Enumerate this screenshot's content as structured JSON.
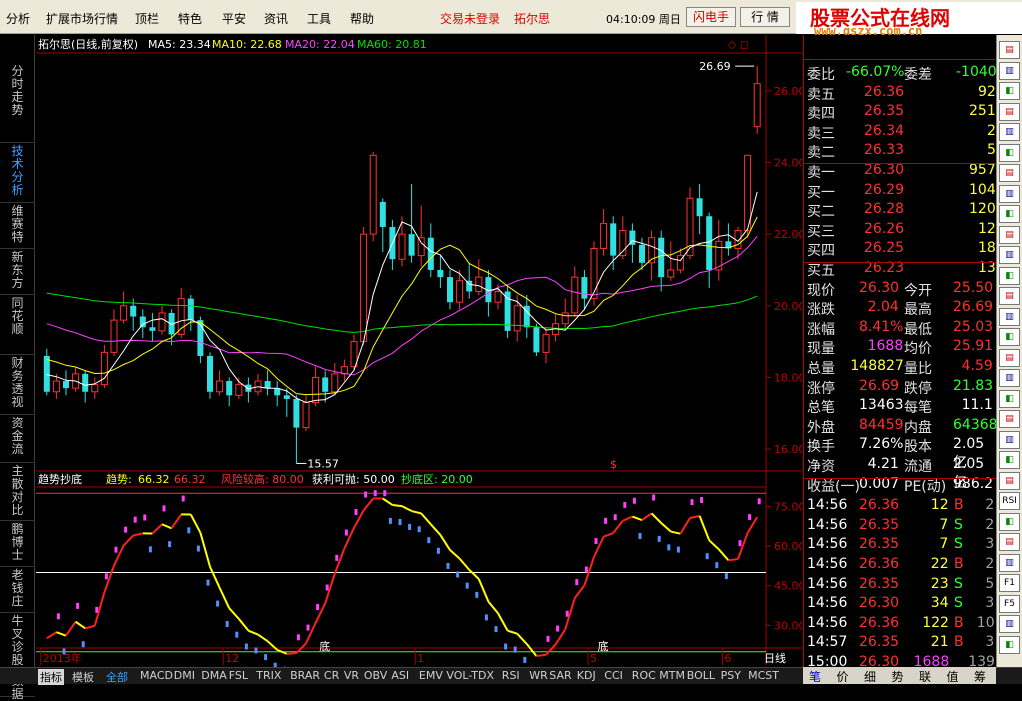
{
  "menu": [
    "分析",
    "扩展市场行情",
    "顶栏",
    "特色",
    "平安",
    "资讯",
    "工具",
    "帮助"
  ],
  "status": {
    "login": "交易未登录",
    "stock": "拓尔思",
    "time": "04:10:09 周日",
    "flash": "闪电手",
    "trade": "行 情"
  },
  "brand": {
    "title": "股票公式在线网",
    "url": "www.gszx.com.cn"
  },
  "left_tabs": [
    "分时走势",
    "技术分析",
    "维赛特",
    "新东方",
    "同花顺",
    "财务透视",
    "资金流",
    "主散对比",
    "鹏博士",
    "老钱庄",
    "牛叉诊股",
    "数据"
  ],
  "chart": {
    "header": {
      "name": "拓尔思(日线,前复权)",
      "ma5": "MA5: 23.34",
      "ma10": "MA10: 22.68",
      "ma20": "MA20: 22.04",
      "ma60": "MA60: 20.81"
    },
    "price_ticks": [
      "26.00",
      "24.00",
      "22.00",
      "20.00",
      "18.00",
      "16.00"
    ],
    "high_label": "26.69",
    "low_label": "15.57",
    "dollar": "$",
    "ind_header": {
      "name": "趋势抄底",
      "trend_label": "趋势:",
      "trend": "66.32",
      "trend2": "66.32",
      "risk": "风险较高: 80.00",
      "profit": "获利可抛: 50.00",
      "bottom": "抄底区: 20.00"
    },
    "ind_ticks": [
      "75.00",
      "60.00",
      "45.00",
      "30.00"
    ],
    "bottom_marks": [
      "底",
      "底"
    ],
    "x_labels": [
      "2013年",
      "12",
      "1",
      "5",
      "6"
    ],
    "period": "日线",
    "colors": {
      "up": "#ff3030",
      "down": "#30e0e0",
      "ma5": "#ffffff",
      "ma10": "#ffff00",
      "ma20": "#ff40ff",
      "ma60": "#00e000"
    }
  },
  "chart_data": {
    "type": "candlestick",
    "title": "拓尔思(日线,前复权)",
    "ylim": [
      15.5,
      27.0
    ],
    "candles": [
      [
        18.6,
        17.6,
        18.8,
        17.5
      ],
      [
        17.6,
        17.9,
        18.1,
        17.4
      ],
      [
        17.9,
        17.7,
        18.2,
        17.5
      ],
      [
        17.7,
        18.1,
        18.3,
        17.6
      ],
      [
        18.1,
        17.6,
        18.2,
        17.3
      ],
      [
        17.6,
        17.8,
        18.0,
        17.4
      ],
      [
        17.8,
        18.7,
        18.9,
        17.7
      ],
      [
        18.7,
        19.6,
        19.9,
        18.6
      ],
      [
        19.6,
        20.0,
        20.4,
        19.5
      ],
      [
        20.0,
        19.7,
        20.2,
        19.3
      ],
      [
        19.7,
        19.4,
        19.9,
        19.1
      ],
      [
        19.4,
        19.3,
        19.8,
        19.0
      ],
      [
        19.3,
        19.8,
        20.0,
        19.2
      ],
      [
        19.8,
        19.2,
        19.9,
        18.9
      ],
      [
        19.2,
        20.2,
        20.5,
        19.1
      ],
      [
        20.2,
        19.6,
        20.3,
        19.3
      ],
      [
        19.6,
        18.6,
        19.7,
        18.4
      ],
      [
        18.6,
        17.6,
        18.7,
        17.4
      ],
      [
        17.6,
        17.9,
        18.2,
        17.5
      ],
      [
        17.9,
        17.5,
        18.0,
        17.2
      ],
      [
        17.5,
        17.8,
        18.0,
        17.4
      ],
      [
        17.8,
        17.6,
        18.0,
        17.3
      ],
      [
        17.6,
        17.9,
        18.1,
        17.5
      ],
      [
        17.9,
        17.7,
        18.2,
        17.5
      ],
      [
        17.7,
        17.5,
        17.9,
        17.2
      ],
      [
        17.5,
        17.4,
        17.7,
        16.9
      ],
      [
        17.4,
        16.6,
        17.5,
        15.6
      ],
      [
        16.6,
        17.3,
        17.5,
        16.5
      ],
      [
        17.3,
        18.0,
        18.3,
        17.2
      ],
      [
        18.0,
        17.6,
        18.2,
        17.3
      ],
      [
        17.6,
        18.1,
        18.4,
        17.5
      ],
      [
        18.1,
        18.3,
        18.5,
        17.9
      ],
      [
        18.3,
        19.0,
        19.2,
        18.2
      ],
      [
        19.0,
        22.0,
        22.2,
        18.9
      ],
      [
        22.0,
        24.2,
        24.3,
        21.8
      ],
      [
        22.9,
        22.2,
        23.0,
        21.5
      ],
      [
        22.2,
        21.3,
        22.4,
        21.0
      ],
      [
        21.3,
        22.0,
        22.5,
        21.1
      ],
      [
        22.0,
        21.4,
        23.4,
        21.2
      ],
      [
        21.4,
        21.9,
        22.8,
        21.1
      ],
      [
        21.9,
        21.0,
        22.3,
        20.8
      ],
      [
        21.0,
        20.8,
        21.4,
        20.5
      ],
      [
        20.8,
        20.1,
        21.0,
        19.9
      ],
      [
        20.1,
        20.7,
        21.0,
        19.9
      ],
      [
        20.7,
        20.4,
        21.2,
        20.2
      ],
      [
        20.4,
        20.8,
        21.3,
        20.3
      ],
      [
        20.8,
        20.1,
        21.0,
        19.7
      ],
      [
        20.1,
        20.4,
        20.6,
        19.9
      ],
      [
        20.4,
        19.3,
        20.6,
        19.1
      ],
      [
        19.3,
        20.0,
        20.3,
        19.0
      ],
      [
        20.0,
        19.4,
        20.3,
        19.1
      ],
      [
        19.4,
        18.7,
        19.5,
        18.6
      ],
      [
        18.7,
        19.2,
        19.4,
        18.4
      ],
      [
        19.2,
        19.5,
        19.8,
        19.0
      ],
      [
        19.5,
        19.8,
        20.2,
        19.3
      ],
      [
        19.8,
        20.8,
        21.1,
        19.7
      ],
      [
        20.8,
        20.2,
        21.0,
        19.9
      ],
      [
        20.2,
        21.6,
        21.8,
        20.0
      ],
      [
        21.6,
        22.3,
        22.7,
        21.4
      ],
      [
        22.3,
        21.4,
        22.5,
        21.0
      ],
      [
        21.4,
        22.1,
        22.5,
        21.3
      ],
      [
        22.1,
        21.7,
        22.3,
        21.2
      ],
      [
        21.7,
        21.2,
        21.9,
        21.0
      ],
      [
        21.2,
        21.9,
        22.1,
        20.7
      ],
      [
        21.9,
        20.8,
        22.1,
        20.4
      ],
      [
        20.8,
        21.0,
        21.8,
        20.7
      ],
      [
        21.0,
        21.4,
        21.6,
        20.9
      ],
      [
        21.4,
        23.0,
        23.3,
        21.3
      ],
      [
        23.0,
        22.5,
        23.4,
        22.0
      ],
      [
        22.5,
        21.0,
        22.6,
        20.5
      ],
      [
        21.0,
        21.8,
        22.4,
        20.7
      ],
      [
        21.8,
        21.6,
        22.3,
        21.4
      ],
      [
        21.6,
        22.1,
        22.2,
        21.3
      ],
      [
        22.1,
        24.2,
        24.2,
        21.9
      ],
      [
        25.0,
        26.2,
        26.69,
        24.8
      ]
    ],
    "indicator": {
      "name": "趋势抄底",
      "trend": 66.32,
      "risk_level": 80.0,
      "profit_level": 50.0,
      "bottom_level": 20.0,
      "ylim": [
        15,
        85
      ]
    }
  },
  "quote": {
    "weibi": {
      "l1": "委比",
      "v1": "-66.07%",
      "l2": "委差",
      "v2": "-1040"
    },
    "sell": [
      {
        "l": "卖五",
        "p": "26.36",
        "v": "92"
      },
      {
        "l": "卖四",
        "p": "26.35",
        "v": "251"
      },
      {
        "l": "卖三",
        "p": "26.34",
        "v": "2"
      },
      {
        "l": "卖二",
        "p": "26.33",
        "v": "5"
      },
      {
        "l": "卖一",
        "p": "26.30",
        "v": "957"
      }
    ],
    "buy": [
      {
        "l": "买一",
        "p": "26.29",
        "v": "104"
      },
      {
        "l": "买二",
        "p": "26.28",
        "v": "120"
      },
      {
        "l": "买三",
        "p": "26.26",
        "v": "12"
      },
      {
        "l": "买四",
        "p": "26.25",
        "v": "18"
      },
      {
        "l": "买五",
        "p": "26.23",
        "v": "13"
      }
    ],
    "stats": [
      {
        "l1": "现价",
        "v1": "26.30",
        "c1": "#ff3030",
        "l2": "今开",
        "v2": "25.50",
        "c2": "#ff3030"
      },
      {
        "l1": "涨跌",
        "v1": "2.04",
        "c1": "#ff3030",
        "l2": "最高",
        "v2": "26.69",
        "c2": "#ff3030"
      },
      {
        "l1": "涨幅",
        "v1": "8.41%",
        "c1": "#ff3030",
        "l2": "最低",
        "v2": "25.03",
        "c2": "#ff3030"
      },
      {
        "l1": "现量",
        "v1": "1688",
        "c1": "#ff40ff",
        "l2": "均价",
        "v2": "25.91",
        "c2": "#ff3030"
      },
      {
        "l1": "总量",
        "v1": "148827",
        "c1": "#ffff40",
        "l2": "量比",
        "v2": "4.59",
        "c2": "#ff3030"
      },
      {
        "l1": "涨停",
        "v1": "26.69",
        "c1": "#ff3030",
        "l2": "跌停",
        "v2": "21.83",
        "c2": "#30ff30"
      },
      {
        "l1": "总笔",
        "v1": "13463",
        "c1": "#ffffff",
        "l2": "每笔",
        "v2": "11.1",
        "c2": "#ffffff"
      },
      {
        "l1": "外盘",
        "v1": "84459",
        "c1": "#ff3030",
        "l2": "内盘",
        "v2": "64368",
        "c2": "#30ff30"
      },
      {
        "l1": "换手",
        "v1": "7.26%",
        "c1": "#ffffff",
        "l2": "股本",
        "v2": "2.05亿",
        "c2": "#ffffff"
      },
      {
        "l1": "净资",
        "v1": "4.21",
        "c1": "#ffffff",
        "l2": "流通",
        "v2": "2.05亿",
        "c2": "#ffffff"
      },
      {
        "l1": "收益(一)",
        "v1": "0.007",
        "c1": "#ffffff",
        "l2": "PE(动)",
        "v2": "986.2",
        "c2": "#ffffff"
      }
    ],
    "ticks": [
      {
        "t": "14:56",
        "p": "26.36",
        "v": "12",
        "s": "B",
        "n": "2"
      },
      {
        "t": "14:56",
        "p": "26.35",
        "v": "7",
        "s": "S",
        "n": "2"
      },
      {
        "t": "14:56",
        "p": "26.35",
        "v": "7",
        "s": "S",
        "n": "3"
      },
      {
        "t": "14:56",
        "p": "26.36",
        "v": "22",
        "s": "B",
        "n": "2"
      },
      {
        "t": "14:56",
        "p": "26.35",
        "v": "23",
        "s": "S",
        "n": "5"
      },
      {
        "t": "14:56",
        "p": "26.30",
        "v": "34",
        "s": "S",
        "n": "3"
      },
      {
        "t": "14:56",
        "p": "26.36",
        "v": "122",
        "s": "B",
        "n": "10"
      },
      {
        "t": "14:57",
        "p": "26.35",
        "v": "21",
        "s": "B",
        "n": "3"
      },
      {
        "t": "15:00",
        "p": "26.30",
        "v": "1688",
        "s": "",
        "n": "139"
      }
    ]
  },
  "bottom_tabs": [
    "指标",
    "模板",
    "全部",
    "MACD",
    "DMI",
    "DMA",
    "FSL",
    "TRIX",
    "BRAR",
    "CR",
    "VR",
    "OBV",
    "ASI",
    "EMV",
    "VOL-TDX",
    "RSI",
    "WR",
    "SAR",
    "KDJ",
    "CCI",
    "ROC",
    "MTM",
    "BOLL",
    "PSY",
    "MCST"
  ],
  "right_tabs": [
    "笔",
    "价",
    "细",
    "势",
    "联",
    "值",
    "筹"
  ],
  "right_tools": [
    "F1",
    "F5",
    "RSI"
  ]
}
